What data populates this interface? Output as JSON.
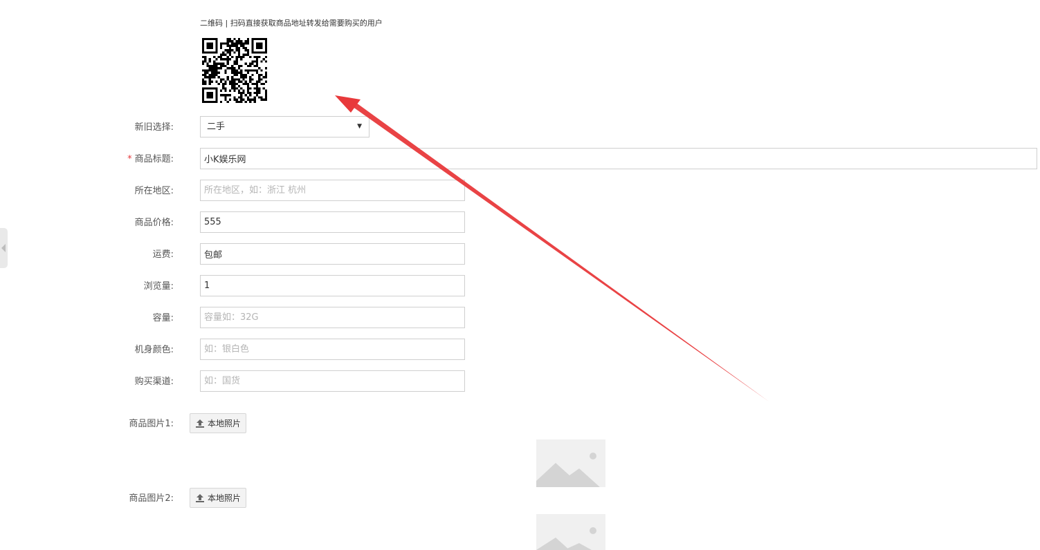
{
  "qr": {
    "caption": "二维码 | 扫码直接获取商品地址转发给需要购买的用户"
  },
  "form": {
    "condition": {
      "label": "新旧选择:",
      "value": "二手"
    },
    "title": {
      "required_mark": "*",
      "label": "商品标题:",
      "value": "小K娱乐网"
    },
    "location": {
      "label": "所在地区:",
      "value": "",
      "placeholder": "所在地区，如：浙江 杭州"
    },
    "price": {
      "label": "商品价格:",
      "value": "555"
    },
    "shipping": {
      "label": "运费:",
      "value": "包邮"
    },
    "views": {
      "label": "浏览量:",
      "value": "1"
    },
    "capacity": {
      "label": "容量:",
      "value": "",
      "placeholder": "容量如：32G"
    },
    "color": {
      "label": "机身颜色:",
      "value": "",
      "placeholder": "如：银白色"
    },
    "channel": {
      "label": "购买渠道:",
      "value": "",
      "placeholder": "如：国货"
    }
  },
  "images": [
    {
      "label": "商品图片1:",
      "button": "本地照片"
    },
    {
      "label": "商品图片2:",
      "button": "本地照片"
    }
  ],
  "colors": {
    "annotation_arrow": "#e8393b",
    "required": "#e4393c",
    "border": "#cfcfcf"
  }
}
